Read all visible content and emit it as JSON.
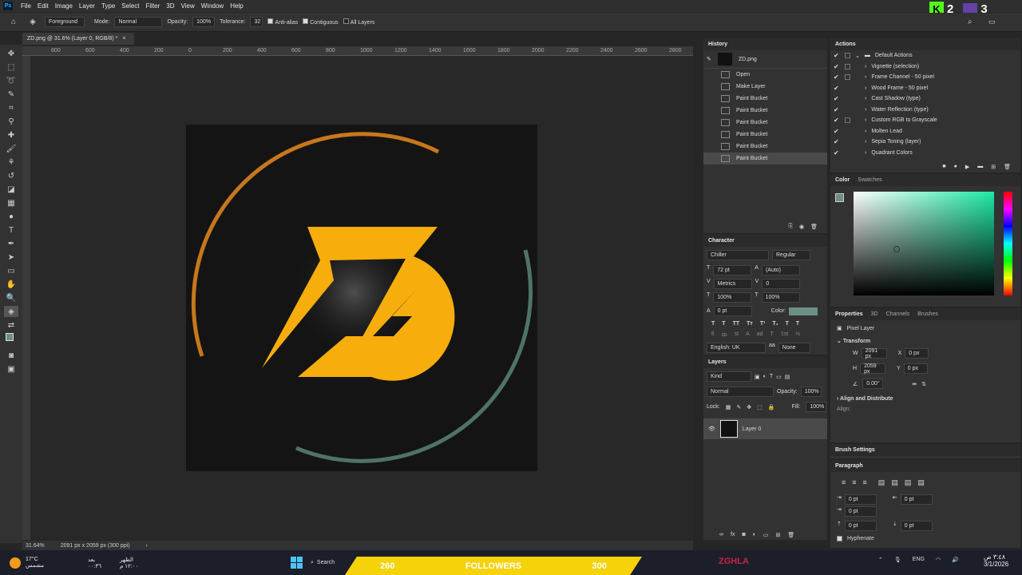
{
  "menu": {
    "logo": "Ps",
    "items": [
      "File",
      "Edit",
      "Image",
      "Layer",
      "Type",
      "Select",
      "Filter",
      "3D",
      "View",
      "Window",
      "Help"
    ]
  },
  "options": {
    "fill_source": "Foreground",
    "mode_label": "Mode:",
    "mode": "Normal",
    "opacity_label": "Opacity:",
    "opacity": "100%",
    "tolerance_label": "Tolerance:",
    "tolerance": "32",
    "antialias": "Anti-alias",
    "contiguous": "Contiguous",
    "all_layers": "All Layers"
  },
  "document": {
    "tab": "ZD.png @ 31.6% (Layer 0, RGB/8) *",
    "zoom": "31.64%",
    "size": "2091 px x 2059 px (300 ppi)"
  },
  "ruler": {
    "h": [
      "800",
      "600",
      "400",
      "200",
      "0",
      "200",
      "400",
      "600",
      "800",
      "1000",
      "1200",
      "1400",
      "1600",
      "1800",
      "2000",
      "2200",
      "2400",
      "2600",
      "2800"
    ]
  },
  "history": {
    "title": "History",
    "snapshot": "ZD.png",
    "steps": [
      "Open",
      "Make Layer",
      "Paint Bucket",
      "Paint Bucket",
      "Paint Bucket",
      "Paint Bucket",
      "Paint Bucket",
      "Paint Bucket"
    ]
  },
  "actions": {
    "title": "Actions",
    "set": "Default Actions",
    "items": [
      "Vignette (selection)",
      "Frame Channel - 50 pixel",
      "Wood Frame - 50 pixel",
      "Cast Shadow (type)",
      "Water Reflection (type)",
      "Custom RGB to Grayscale",
      "Molten Lead",
      "Sepia Toning (layer)",
      "Quadrant Colors"
    ]
  },
  "color": {
    "tab1": "Color",
    "tab2": "Swatches",
    "fg": "#6b8f86"
  },
  "character": {
    "title": "Character",
    "font": "Chiller",
    "style": "Regular",
    "size": "72 pt",
    "leading": "(Auto)",
    "kerning": "Metrics",
    "tracking": "0",
    "vscale": "100%",
    "hscale": "100%",
    "baseline": "0 pt",
    "color_label": "Color:",
    "lang": "English: UK",
    "aa": "None"
  },
  "properties": {
    "tabs": [
      "Properties",
      "3D",
      "Channels",
      "Brushes"
    ],
    "kind": "Pixel Layer",
    "transform": "Transform",
    "w_label": "W",
    "w": "2091 px",
    "h_label": "H",
    "h": "2059 px",
    "x_label": "X",
    "x": "0 px",
    "y_label": "Y",
    "y": "0 px",
    "angle": "0.00°",
    "align": "Align and Distribute",
    "align_label": "Align:"
  },
  "layers": {
    "title": "Layers",
    "kind": "Kind",
    "blend": "Normal",
    "opacity_label": "Opacity:",
    "opacity": "100%",
    "lock_label": "Lock:",
    "fill_label": "Fill:",
    "fill": "100%",
    "layer": "Layer 0"
  },
  "brush": {
    "title": "Brush Settings"
  },
  "paragraph": {
    "title": "Paragraph",
    "vals": [
      "0 pt",
      "0 pt",
      "0 pt",
      "0 pt",
      "0 pt"
    ],
    "hyphenate": "Hyphenate"
  },
  "taskbar": {
    "weather": "17°C",
    "weather_sub": "مشمس",
    "prayer1": "بعد",
    "prayer1b": "٠٠:٣٦",
    "prayer2": "الظهر",
    "prayer2b": "١٢:٠٠ م",
    "search": "Search",
    "lang": "ENG",
    "time": "٣:٤٨ ص",
    "date": "3/1/2026",
    "f_left": "260",
    "f_mid": "FOLLOWERS",
    "f_right": "300",
    "brand": "ZGHLA",
    "k_num": "2",
    "k2_num": "3"
  }
}
